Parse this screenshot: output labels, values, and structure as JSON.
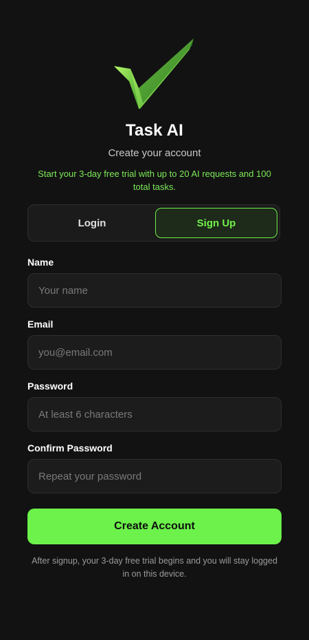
{
  "app": {
    "title": "Task AI",
    "subtitle": "Create your account",
    "promo": "Start your 3-day free trial with up to 20 AI requests and 100 total tasks.",
    "logo_icon": "checkmark-icon"
  },
  "tabs": {
    "login_label": "Login",
    "signup_label": "Sign Up",
    "active": "Sign Up"
  },
  "form": {
    "name": {
      "label": "Name",
      "placeholder": "Your name",
      "value": ""
    },
    "email": {
      "label": "Email",
      "placeholder": "you@email.com",
      "value": ""
    },
    "password": {
      "label": "Password",
      "placeholder": "At least 6 characters",
      "value": ""
    },
    "confirm": {
      "label": "Confirm Password",
      "placeholder": "Repeat your password",
      "value": ""
    },
    "submit_label": "Create Account"
  },
  "footnote": "After signup, your 3-day free trial begins and you will stay logged in on this device.",
  "colors": {
    "background": "#121212",
    "accent": "#6cf24a",
    "promo_text": "#7dea5a",
    "field_bg": "#1c1c1c"
  }
}
